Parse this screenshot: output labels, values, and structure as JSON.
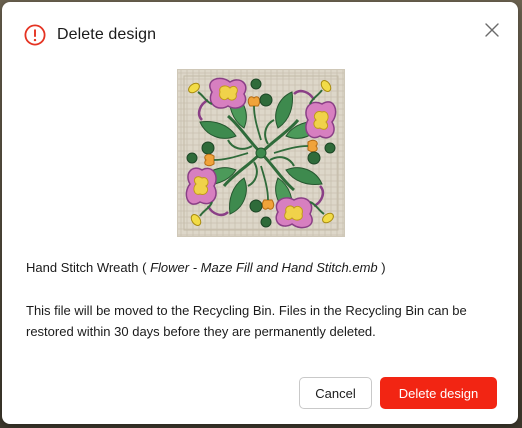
{
  "dialog": {
    "title": "Delete design",
    "design_name": "Hand Stitch Wreath",
    "open_paren": "(",
    "file_name": "Flower - Maze Fill and Hand Stitch.emb",
    "close_paren": ")",
    "message": "This file will be moved to the Recycling Bin. Files in the Recycling Bin can be restored within 30 days before they are permanently deleted.",
    "cancel_label": "Cancel",
    "delete_label": "Delete design"
  },
  "icons": {
    "warning": "warning-circle-icon",
    "close": "close-icon"
  },
  "colors": {
    "danger": "#f22513",
    "warning_icon": "#e53322",
    "text": "#1b1b1b"
  }
}
